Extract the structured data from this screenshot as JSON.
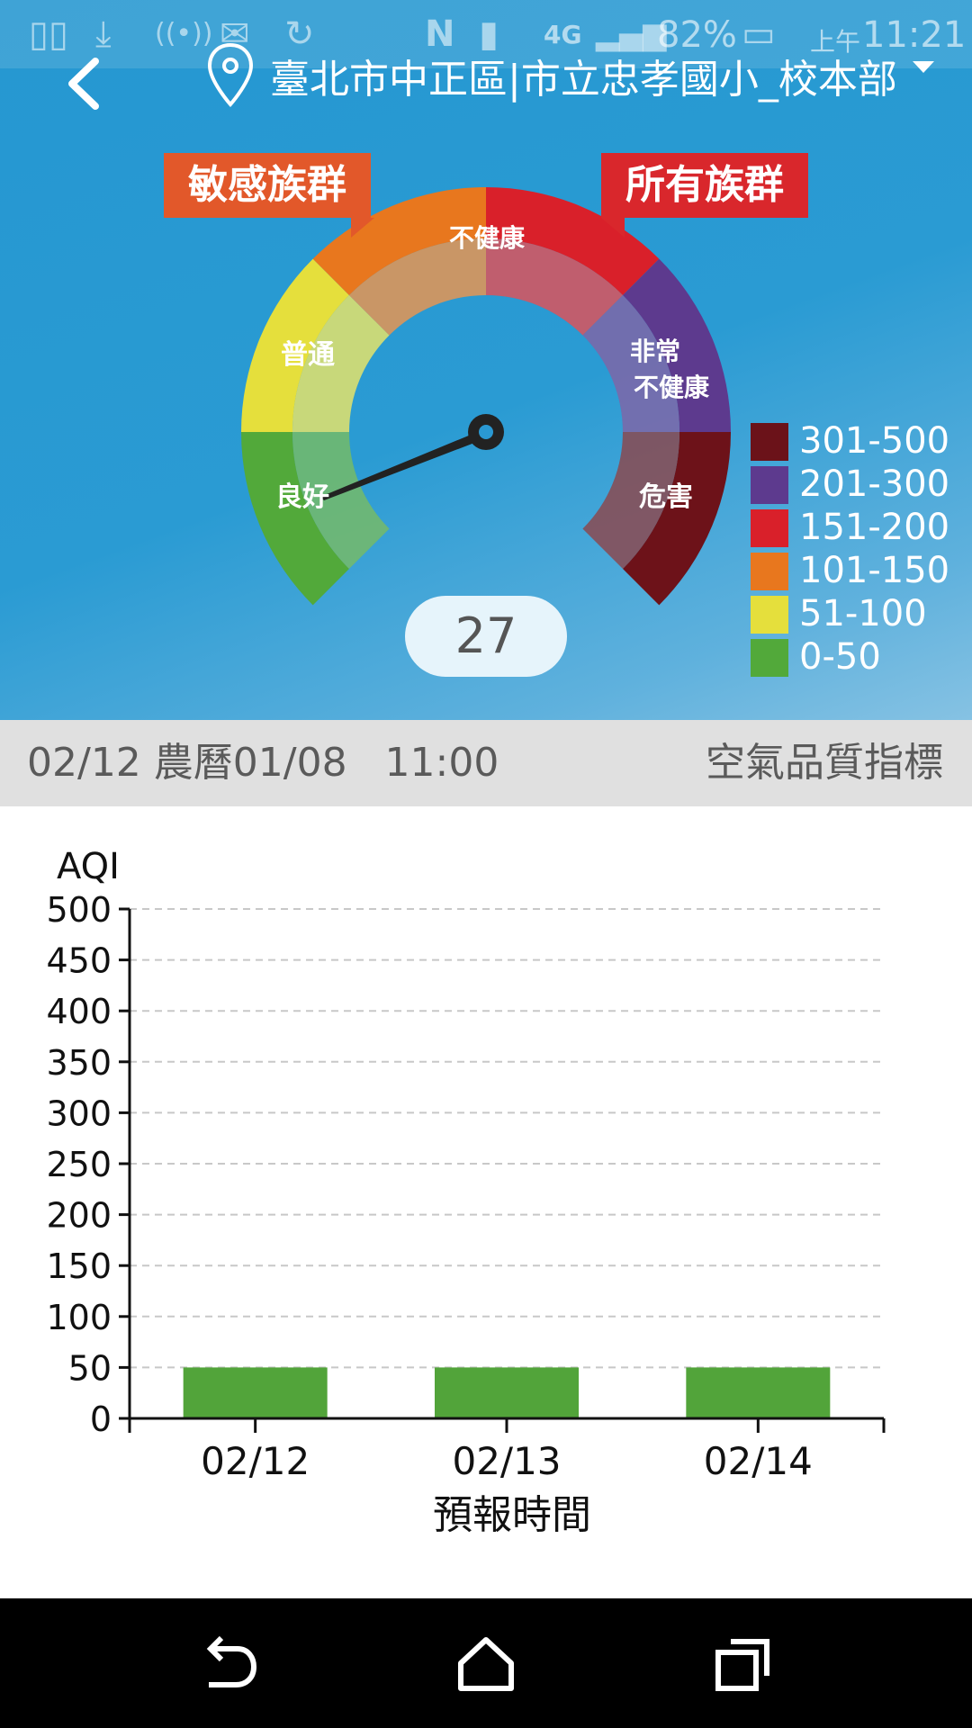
{
  "status_bar": {
    "battery": "82%",
    "time_prefix": "上午",
    "time": "11:21",
    "network": "4G"
  },
  "header": {
    "station": "臺北市中正區|市立忠孝國小_校本部"
  },
  "gauge": {
    "tag_sensitive": "敏感族群",
    "tag_all": "所有族群",
    "segments": [
      {
        "label": "良好",
        "color": "#52a93a"
      },
      {
        "label": "普通",
        "color": "#e5df3c"
      },
      {
        "label": "不健康",
        "color": "#e8771e"
      },
      {
        "label": "不健康",
        "color": "#d9202a"
      },
      {
        "label": "非常不健康",
        "color": "#5d3a8e"
      },
      {
        "label": "危害",
        "color": "#6d1219"
      }
    ],
    "label_good": "良好",
    "label_moderate": "普通",
    "label_unhealthy": "不健康",
    "label_very_1": "非常",
    "label_very_2": "不健康",
    "label_hazard": "危害",
    "value": "27"
  },
  "legend": [
    {
      "label": "301-500",
      "color": "#6b1219"
    },
    {
      "label": "201-300",
      "color": "#5d3a8e"
    },
    {
      "label": "151-200",
      "color": "#d9202a"
    },
    {
      "label": "101-150",
      "color": "#e8771e"
    },
    {
      "label": "51-100",
      "color": "#e5df3c"
    },
    {
      "label": "0-50",
      "color": "#52a93a"
    }
  ],
  "info": {
    "date": "02/12 農曆01/08   11:00",
    "index_label": "空氣品質指標"
  },
  "chart_data": {
    "type": "bar",
    "ylabel": "AQI",
    "xlabel": "預報時間",
    "categories": [
      "02/12",
      "02/13",
      "02/14"
    ],
    "values": [
      50,
      50,
      50
    ],
    "ylim": [
      0,
      500
    ],
    "yticks": [
      0,
      50,
      100,
      150,
      200,
      250,
      300,
      350,
      400,
      450,
      500
    ],
    "grid": true,
    "bar_color": "#52a43a"
  }
}
